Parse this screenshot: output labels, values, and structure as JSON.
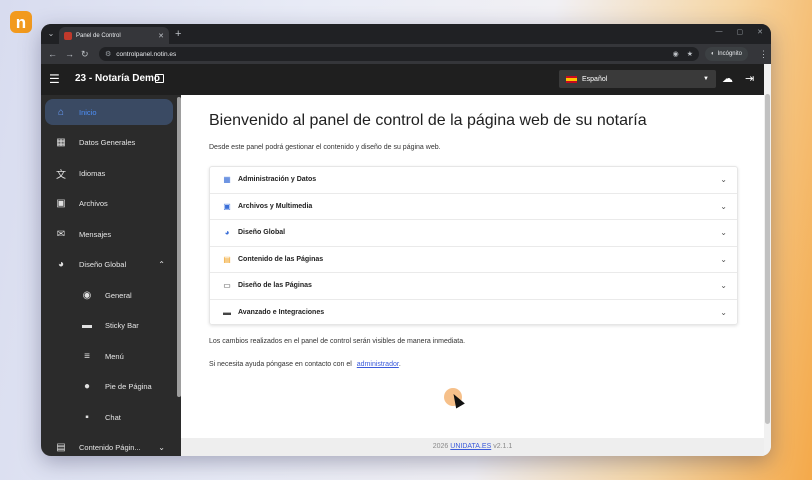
{
  "logo": {
    "glyph": "n"
  },
  "browser": {
    "tab_title": "Panel de Control",
    "url": "controlpanel.notin.es",
    "incognito_label": "Incógnito"
  },
  "app": {
    "title": "23 - Notaría Demo",
    "language": "Español"
  },
  "sidebar": {
    "items": [
      {
        "label": "Inicio",
        "icon": "home-icon",
        "active": true
      },
      {
        "label": "Datos Generales",
        "icon": "grid-icon"
      },
      {
        "label": "Idiomas",
        "icon": "translate-icon"
      },
      {
        "label": "Archivos",
        "icon": "images-icon"
      },
      {
        "label": "Mensajes",
        "icon": "mail-icon"
      },
      {
        "label": "Diseño Global",
        "icon": "palette-icon",
        "expanded": true
      },
      {
        "label": "General",
        "icon": "toggle-icon",
        "sub": true
      },
      {
        "label": "Sticky Bar",
        "icon": "bar-icon",
        "sub": true
      },
      {
        "label": "Menú",
        "icon": "menu-icon",
        "sub": true
      },
      {
        "label": "Pie de Página",
        "icon": "info-icon",
        "sub": true
      },
      {
        "label": "Chat",
        "icon": "chat-icon",
        "sub": true
      },
      {
        "label": "Contenido Págin...",
        "icon": "document-icon",
        "expanded": false
      }
    ]
  },
  "main": {
    "headline": "Bienvenido al panel de control de la página web de su notaría",
    "intro": "Desde este panel podrá gestionar el contenido y diseño de su página web.",
    "sections": [
      {
        "label": "Administración y Datos",
        "icon": "grid-icon",
        "color": "#3b6fd8"
      },
      {
        "label": "Archivos y Multimedia",
        "icon": "images-icon",
        "color": "#3b6fd8"
      },
      {
        "label": "Diseño Global",
        "icon": "palette-icon",
        "color": "#3b6fd8"
      },
      {
        "label": "Contenido de las Páginas",
        "icon": "document-icon",
        "color": "#f0a020"
      },
      {
        "label": "Diseño de las Páginas",
        "icon": "monitor-icon",
        "color": "#444444"
      },
      {
        "label": "Avanzado e Integraciones",
        "icon": "toolbox-icon",
        "color": "#444444"
      }
    ],
    "note_changes": "Los cambios realizados en el panel de control serán visibles de manera inmediata.",
    "note_help": "Si necesita ayuda póngase en contacto con el",
    "help_link": "administrador",
    "help_end": "."
  },
  "footer": {
    "year": "2026",
    "brand": "UNIDATA.ES",
    "version": "v2.1.1"
  },
  "colors": {
    "active_nav": "#4d8ff7",
    "appbar": "#1f1f1f",
    "sidebar": "#2b2b2b",
    "link": "#3b5bdb"
  }
}
